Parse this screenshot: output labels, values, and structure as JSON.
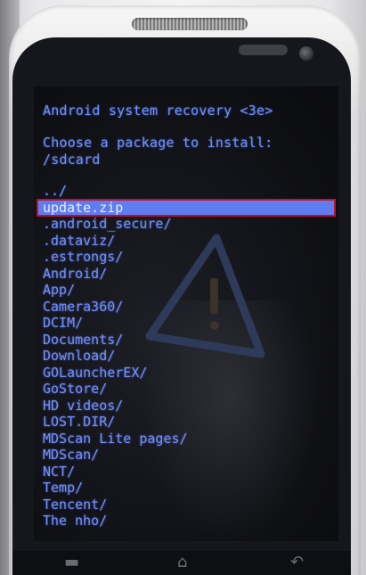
{
  "recovery": {
    "title": "Android system recovery <3e>",
    "prompt_line1": "Choose a package to install:",
    "prompt_line2": "/sdcard",
    "selected_index": 1,
    "entries": [
      "../",
      "update.zip",
      ".android_secure/",
      ".dataviz/",
      ".estrongs/",
      "Android/",
      "App/",
      "Camera360/",
      "DCIM/",
      "Documents/",
      "Download/",
      "GOLauncherEX/",
      "GoStore/",
      "HD videos/",
      "LOST.DIR/",
      "MDScan Lite pages/",
      "MDScan/",
      "NCT/",
      "Temp/",
      "Tencent/",
      "The nho/"
    ]
  },
  "colors": {
    "text": "#6f8dff",
    "highlight": "#5f7cf0",
    "selection_border": "#c0102a",
    "screen_bg": "#0f1014"
  },
  "icons": {
    "warning": "warning-triangle-icon",
    "nav_menu": "menu-icon",
    "nav_home": "home-icon",
    "nav_back": "back-icon"
  }
}
